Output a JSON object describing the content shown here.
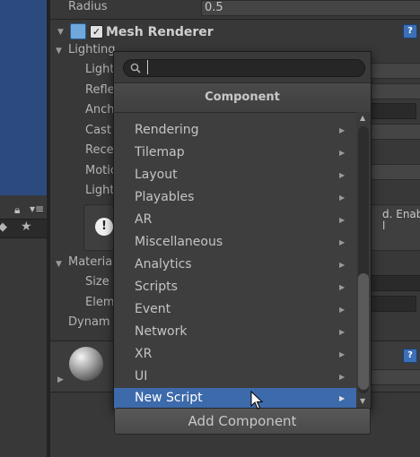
{
  "inspector": {
    "radius": {
      "label": "Radius",
      "value": "0.5"
    },
    "component_title": "Mesh Renderer",
    "lighting_label": "Lighting",
    "rows_truncated": [
      "Light",
      "Refle",
      "Anch",
      "Cast",
      "Rece",
      "Motic",
      "Light"
    ],
    "warning_text": "d. Enable\nl",
    "materials_label": "Materia",
    "size_label": "Size",
    "element_label": "Elem",
    "dynamic_label": "Dynam"
  },
  "popup": {
    "search": {
      "placeholder": "",
      "value": ""
    },
    "header": "Component",
    "items": [
      {
        "label": "Rendering"
      },
      {
        "label": "Tilemap"
      },
      {
        "label": "Layout"
      },
      {
        "label": "Playables"
      },
      {
        "label": "AR"
      },
      {
        "label": "Miscellaneous"
      },
      {
        "label": "Analytics"
      },
      {
        "label": "Scripts"
      },
      {
        "label": "Event"
      },
      {
        "label": "Network"
      },
      {
        "label": "XR"
      },
      {
        "label": "UI"
      },
      {
        "label": "New Script"
      }
    ],
    "selected_item": "New Script"
  },
  "add_component_label": "Add Component",
  "colors": {
    "background": "#383838",
    "scene_blue": "#2c4a7e",
    "selection": "#3d6aab",
    "help_icon": "#3b6fb8"
  },
  "icons": [
    "search-icon",
    "lock-icon",
    "menu-icon",
    "tag-icon",
    "star-icon",
    "mesh-renderer-icon",
    "help-icon",
    "warning-icon",
    "material-sphere-icon",
    "submenu-arrow-icon",
    "scroll-up-icon",
    "scroll-down-icon",
    "cursor-icon"
  ]
}
